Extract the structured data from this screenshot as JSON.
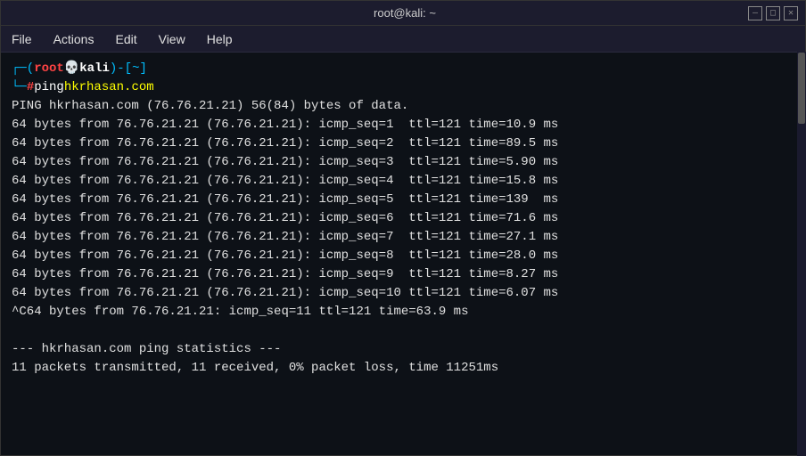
{
  "titleBar": {
    "title": "root@kali: ~",
    "minimizeBtn": "—",
    "maximizeBtn": "□",
    "closeBtn": "✕"
  },
  "menuBar": {
    "items": [
      "File",
      "Actions",
      "Edit",
      "View",
      "Help"
    ]
  },
  "terminal": {
    "promptLine1Top": "┌─(",
    "promptUser": "root",
    "promptSkull": "💀",
    "promptHost": "kali",
    "promptDirBracket1": ")-[",
    "promptDir": "~",
    "promptDirBracket2": "]",
    "promptLine2": "└─",
    "promptHash": "#",
    "command": " ping hkrhasan.com",
    "lines": [
      "PING hkrhasan.com (76.76.21.21) 56(84) bytes of data.",
      "64 bytes from 76.76.21.21 (76.76.21.21): icmp_seq=1  ttl=121 time=10.9 ms",
      "64 bytes from 76.76.21.21 (76.76.21.21): icmp_seq=2  ttl=121 time=89.5 ms",
      "64 bytes from 76.76.21.21 (76.76.21.21): icmp_seq=3  ttl=121 time=5.90 ms",
      "64 bytes from 76.76.21.21 (76.76.21.21): icmp_seq=4  ttl=121 time=15.8 ms",
      "64 bytes from 76.76.21.21 (76.76.21.21): icmp_seq=5  ttl=121 time=139  ms",
      "64 bytes from 76.76.21.21 (76.76.21.21): icmp_seq=6  ttl=121 time=71.6 ms",
      "64 bytes from 76.76.21.21 (76.76.21.21): icmp_seq=7  ttl=121 time=27.1 ms",
      "64 bytes from 76.76.21.21 (76.76.21.21): icmp_seq=8  ttl=121 time=28.0 ms",
      "64 bytes from 76.76.21.21 (76.76.21.21): icmp_seq=9  ttl=121 time=8.27 ms",
      "64 bytes from 76.76.21.21 (76.76.21.21): icmp_seq=10 ttl=121 time=6.07 ms",
      "^C64 bytes from 76.76.21.21: icmp_seq=11 ttl=121 time=63.9 ms",
      "",
      "--- hkrhasan.com ping statistics ---",
      "11 packets transmitted, 11 received, 0% packet loss, time 11251ms"
    ]
  }
}
